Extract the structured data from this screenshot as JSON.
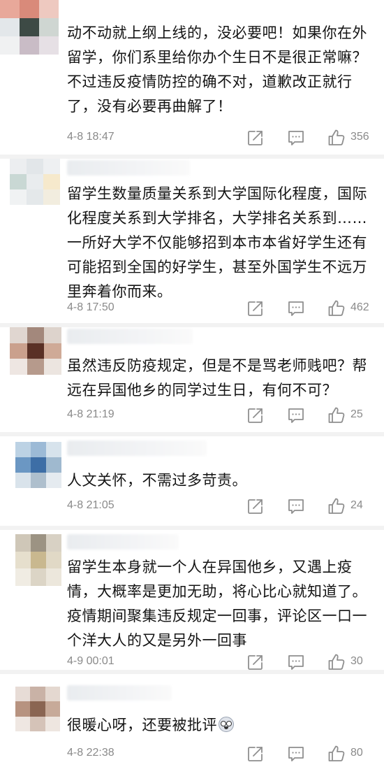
{
  "comments": [
    {
      "text": "动不动就上纲上线的，没必要吧！如果你在外留学，你们系里给你办个生日不是很正常嘛？不过违反疫情防控的确不对，道歉改正就行了，没有必要再曲解了！",
      "time": "4-8 18:47",
      "likes": "356",
      "avatar_colors": [
        "#e8a89a",
        "#d98a7a",
        "#eec9c0",
        "#e3e7ea",
        "#3d4a45",
        "#cfd6d2",
        "#f0f1f2",
        "#c9bcc6",
        "#e6e0e5"
      ]
    },
    {
      "text": "留学生数量质量关系到大学国际化程度，国际化程度关系到大学排名，大学排名关系到……一所好大学不仅能够招到本市本省好学生还有可能招到全国的好学生，甚至外国学生不远万里奔着你而来。",
      "time": "4-8 17:50",
      "likes": "462",
      "avatar_colors": [
        "#eceef0",
        "#e2e6e9",
        "#eef0f2",
        "#c9d8d4",
        "#e9ecee",
        "#f6e9cc",
        "#f0f2f3",
        "#e4e8ea",
        "#f2eddf"
      ]
    },
    {
      "text": "虽然违反防疫规定，但是不是骂老师贱吧？帮远在异国他乡的同学过生日，有何不可？",
      "time": "4-8 21:19",
      "likes": "25",
      "avatar_colors": [
        "#e0d6d0",
        "#a3887c",
        "#ddd3cc",
        "#caa08d",
        "#5a3025",
        "#cfaa97",
        "#eee6e2",
        "#b69a8c",
        "#ece5e0"
      ]
    },
    {
      "text": "人文关怀，不需过多苛责。",
      "time": "4-8 21:05",
      "likes": "24",
      "avatar_colors": [
        "#bcd2e4",
        "#9cbad6",
        "#d7e3ec",
        "#6b97c3",
        "#3d6ea6",
        "#9fb9cf",
        "#d9e3eb",
        "#aebfcd",
        "#e5ebf0"
      ]
    },
    {
      "text": "留学生本身就一个人在异国他乡，又遇上疫情，大概率是更加无助，将心比心就知道了。疫情期间聚集违反规定一回事，评论区一口一个洋大人的又是另外一回事",
      "time": "4-9 00:01",
      "likes": "30",
      "avatar_colors": [
        "#cfc7b8",
        "#9c9383",
        "#d8d1c4",
        "#e6dfcd",
        "#c9b88f",
        "#e1d9c6",
        "#f0ece3",
        "#dcd5c6",
        "#ece7dc"
      ]
    },
    {
      "text": "很暖心呀，还要被批评",
      "time": "4-8 22:38",
      "likes": "80",
      "has_emoji": true,
      "avatar_colors": [
        "#e7dcd6",
        "#c9b2a6",
        "#e4d8d0",
        "#b79380",
        "#8a6552",
        "#c7aa99",
        "#efe7e2",
        "#d5c3b8",
        "#eee6e0"
      ]
    }
  ],
  "icons": {
    "share": "share-icon",
    "reply": "comment-icon",
    "like": "thumbs-up-icon"
  }
}
